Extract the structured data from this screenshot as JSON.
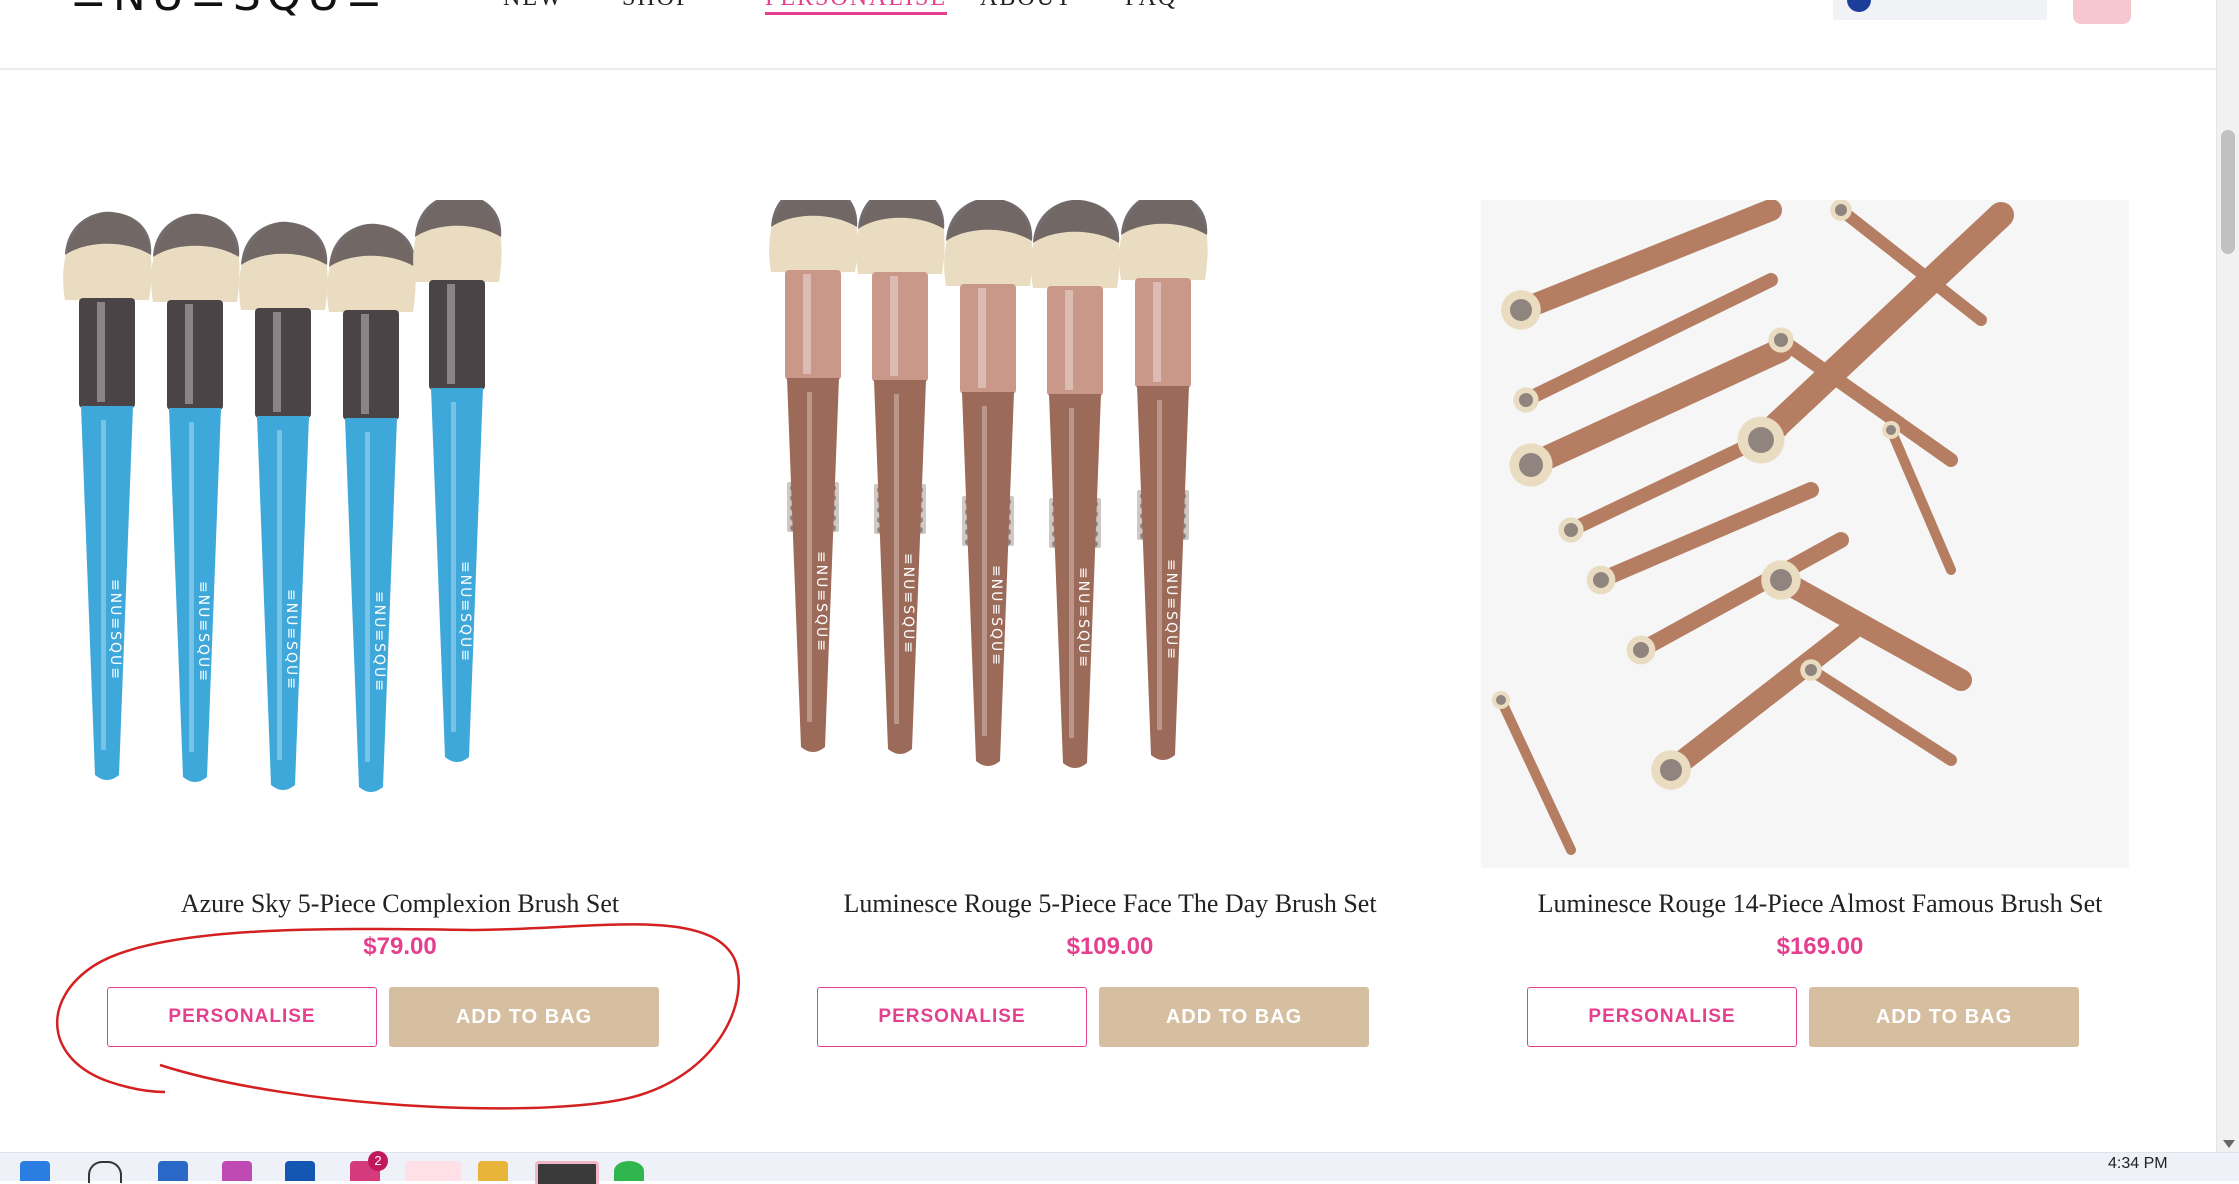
{
  "header": {
    "logo_text": "≡NU≡SQU≡",
    "nav": [
      {
        "label": "NEW"
      },
      {
        "label": "SHOP"
      },
      {
        "label": "PERSONALISE"
      },
      {
        "label": "ABOUT"
      },
      {
        "label": "FAQ"
      }
    ],
    "active_nav": "PERSONALISE"
  },
  "products": [
    {
      "title": "Azure Sky 5-Piece Complexion Brush Set",
      "price": "$79.00",
      "personalise_label": "PERSONALISE",
      "add_to_bag_label": "ADD TO BAG",
      "brush_handle_color": "#3ea8db",
      "brush_count": 5
    },
    {
      "title": "Luminesce Rouge 5-Piece Face The Day Brush Set",
      "price": "$109.00",
      "personalise_label": "PERSONALISE",
      "add_to_bag_label": "ADD TO BAG",
      "brush_handle_color": "#9c6a58",
      "brush_count": 5
    },
    {
      "title": "Luminesce Rouge 14-Piece Almost Famous Brush Set",
      "price": "$169.00",
      "personalise_label": "PERSONALISE",
      "add_to_bag_label": "ADD TO BAG",
      "brush_handle_color": "#b57e62",
      "brush_count": 14
    }
  ],
  "brush_engraving": "≡NU≡SQU≡",
  "taskbar": {
    "clock": "4:34 PM",
    "badge_count": "2"
  },
  "colors": {
    "accent_pink": "#e5408e",
    "add_to_bag_bg": "#d6bfa1",
    "annotation_red": "#d42020"
  }
}
